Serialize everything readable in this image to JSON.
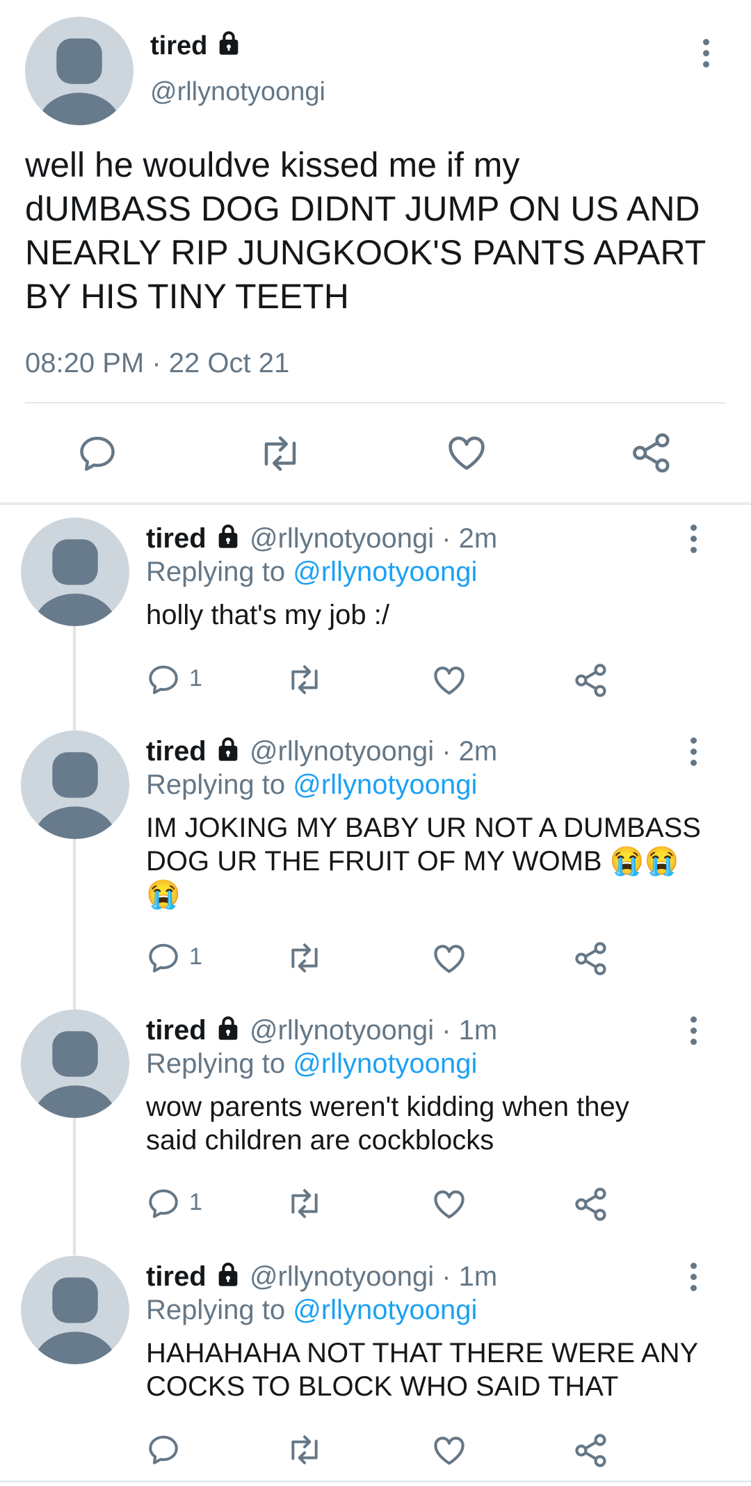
{
  "main_tweet": {
    "display_name": "tired",
    "handle": "@rllynotyoongi",
    "text_lines": [
      "well he wouldve kissed me if my",
      "dUMBASS DOG DIDNT JUMP ON US AND",
      "NEARLY RIP JUNGKOOK'S PANTS APART",
      "BY HIS TINY TEETH"
    ],
    "timestamp": "08:20 PM · 22 Oct 21"
  },
  "replies": [
    {
      "display_name": "tired",
      "handle_time": "@rllynotyoongi · 2m",
      "replying_label": "Replying to",
      "replying_to": "@rllynotyoongi",
      "text_lines": [
        "holly that's my job :/"
      ],
      "reply_count": "1"
    },
    {
      "display_name": "tired",
      "handle_time": "@rllynotyoongi · 2m",
      "replying_label": "Replying to",
      "replying_to": "@rllynotyoongi",
      "text_lines": [
        "IM JOKING MY BABY UR NOT A DUMBASS",
        "DOG UR THE FRUIT OF MY WOMB 😭😭",
        "😭"
      ],
      "reply_count": "1"
    },
    {
      "display_name": "tired",
      "handle_time": "@rllynotyoongi · 1m",
      "replying_label": "Replying to",
      "replying_to": "@rllynotyoongi",
      "text_lines": [
        "wow parents weren't kidding when they",
        "said children are cockblocks"
      ],
      "reply_count": "1"
    },
    {
      "display_name": "tired",
      "handle_time": "@rllynotyoongi · 1m",
      "replying_label": "Replying to",
      "replying_to": "@rllynotyoongi",
      "text_lines": [
        "HAHAHAHA NOT THAT THERE WERE ANY",
        "COCKS TO BLOCK WHO SAID THAT"
      ],
      "reply_count": ""
    }
  ],
  "colors": {
    "accent": "#1da1f2",
    "muted": "#657786",
    "avatar_bg": "#cdd6dd",
    "avatar_fg": "#687b8c",
    "divider": "#e1e8ed"
  },
  "icons": [
    "lock-icon",
    "more-options-icon",
    "reply-icon",
    "retweet-icon",
    "like-icon",
    "share-icon",
    "avatar-placeholder-icon"
  ]
}
